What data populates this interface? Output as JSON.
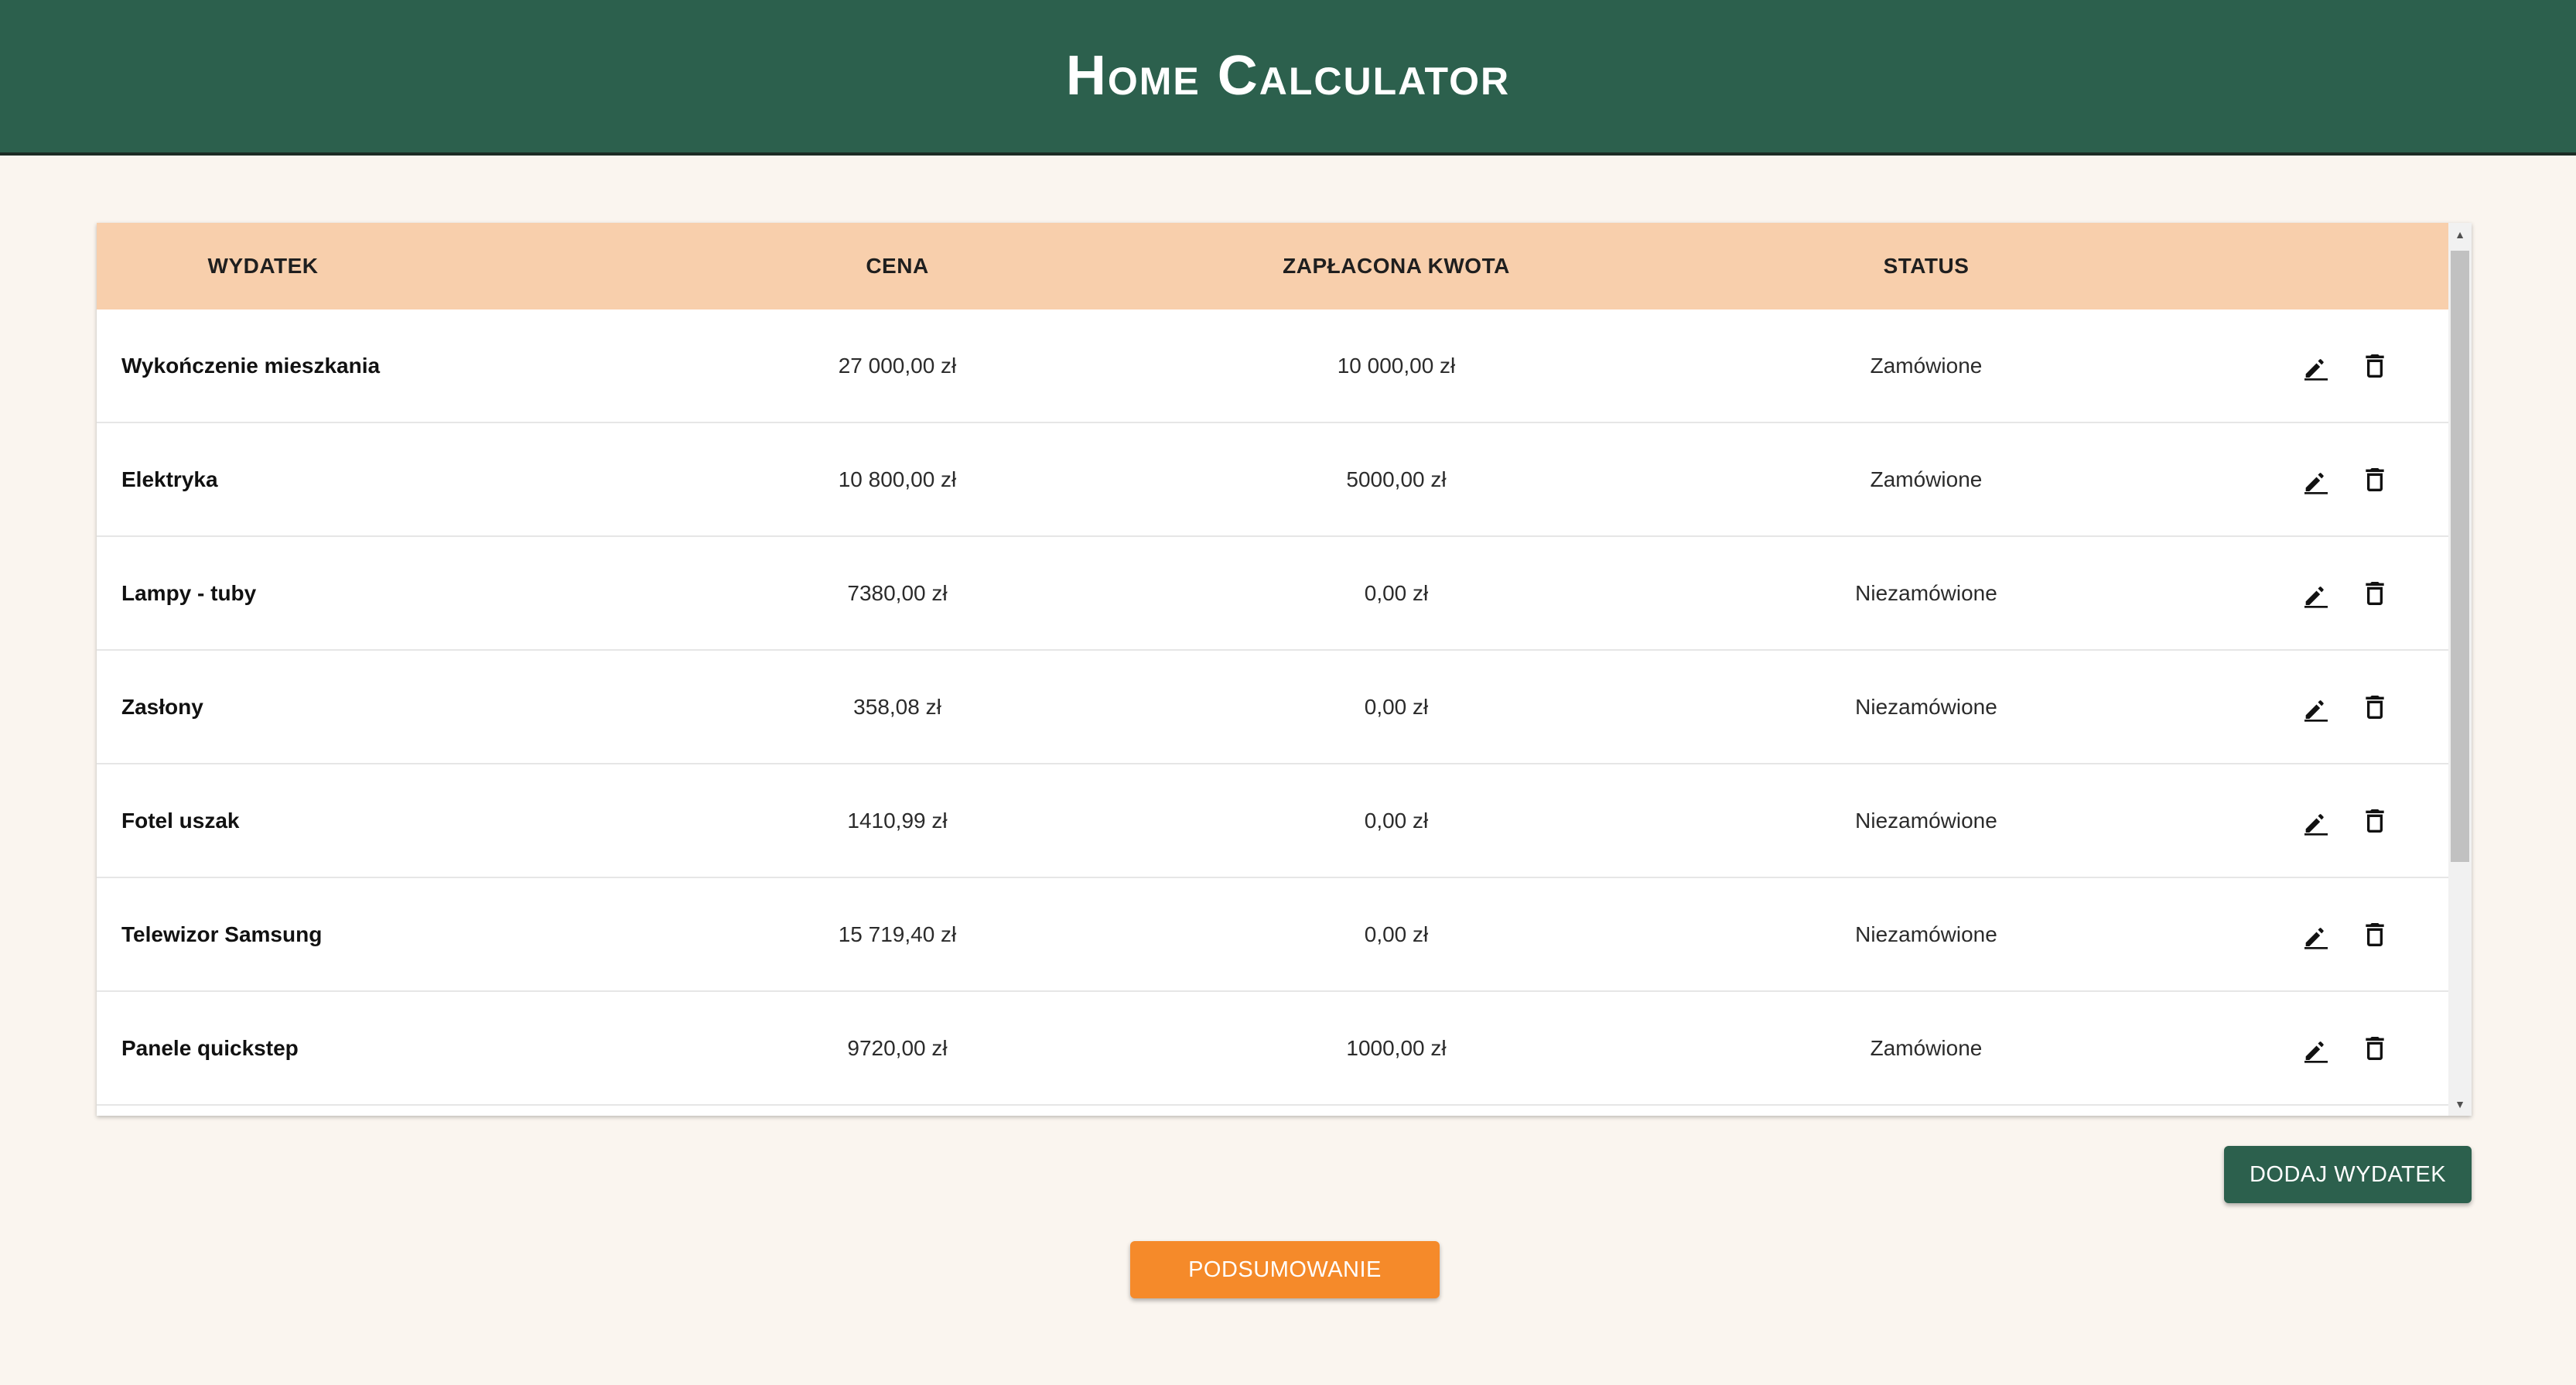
{
  "header": {
    "title": "Home Calculator"
  },
  "table": {
    "columns": [
      "WYDATEK",
      "CENA",
      "ZAPŁACONA KWOTA",
      "STATUS"
    ],
    "rows": [
      {
        "name": "Wykończenie mieszkania",
        "price": "27 000,00 zł",
        "paid": "10 000,00 zł",
        "status": "Zamówione"
      },
      {
        "name": "Elektryka",
        "price": "10 800,00 zł",
        "paid": "5000,00 zł",
        "status": "Zamówione"
      },
      {
        "name": "Lampy - tuby",
        "price": "7380,00 zł",
        "paid": "0,00 zł",
        "status": "Niezamówione"
      },
      {
        "name": "Zasłony",
        "price": "358,08 zł",
        "paid": "0,00 zł",
        "status": "Niezamówione"
      },
      {
        "name": "Fotel uszak",
        "price": "1410,99 zł",
        "paid": "0,00 zł",
        "status": "Niezamówione"
      },
      {
        "name": "Telewizor Samsung",
        "price": "15 719,40 zł",
        "paid": "0,00 zł",
        "status": "Niezamówione"
      },
      {
        "name": "Panele quickstep",
        "price": "9720,00 zł",
        "paid": "1000,00 zł",
        "status": "Zamówione"
      }
    ],
    "row_actions": [
      "edit-icon",
      "delete-icon"
    ]
  },
  "buttons": {
    "add_expense": "Dodaj wydatek",
    "summary": "Podsumowanie"
  },
  "colors": {
    "header_bg": "#2c604d",
    "table_header_bg": "#f8cfac",
    "page_bg": "#faf5ef",
    "add_button_bg": "#2c604d",
    "summary_button_bg": "#f58a2a"
  }
}
